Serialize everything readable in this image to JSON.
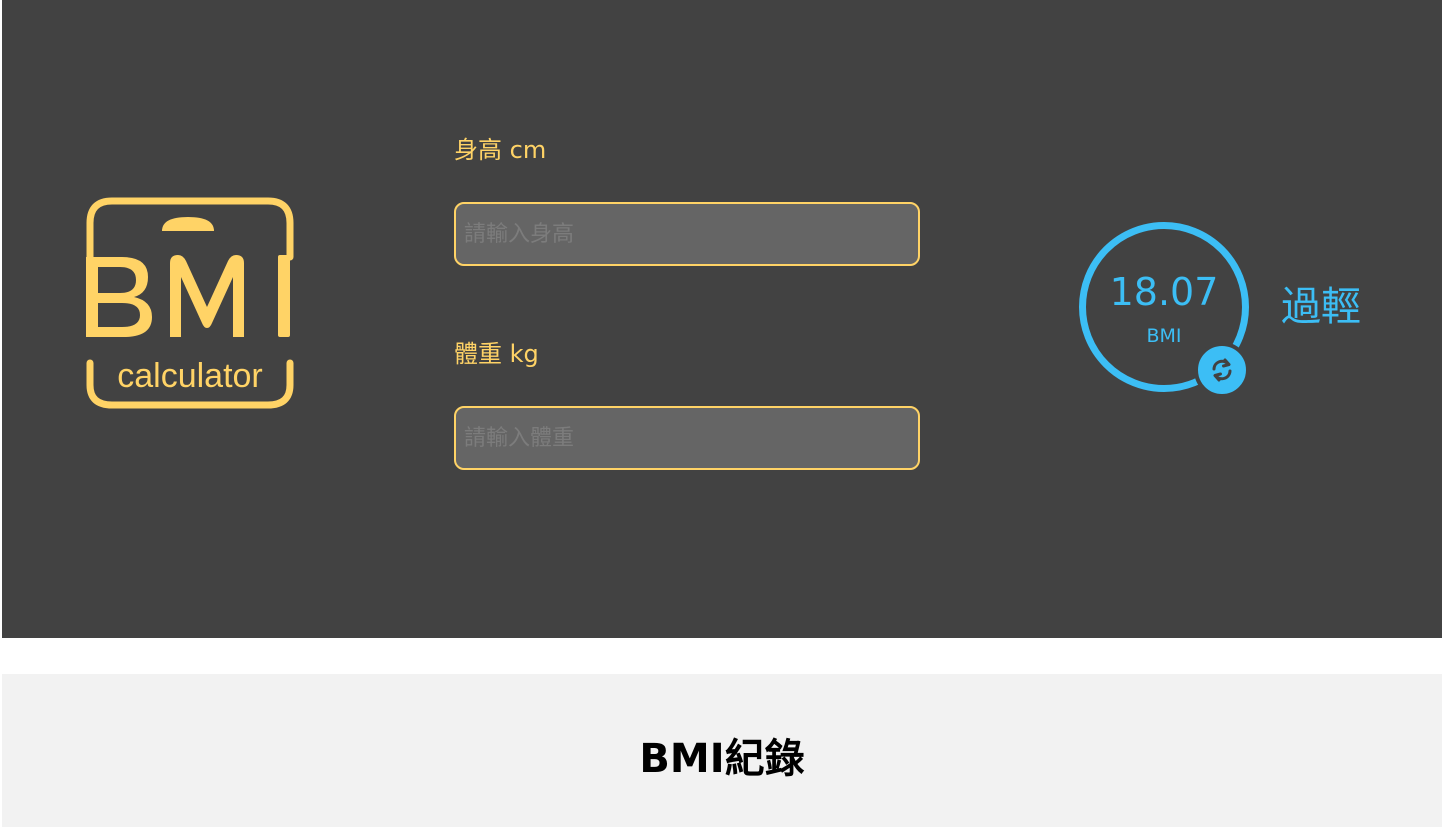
{
  "colors": {
    "header_bg": "#424242",
    "accent_yellow": "#FFD366",
    "result_blue": "#3CBEF5",
    "records_bg": "#F2F2F2"
  },
  "logo": {
    "title": "BMI",
    "subtitle": "calculator"
  },
  "form": {
    "height_label": "身高 cm",
    "height_placeholder": "請輸入身高",
    "height_value": "",
    "weight_label": "體重 kg",
    "weight_placeholder": "請輸入體重",
    "weight_value": ""
  },
  "result": {
    "value": "18.07",
    "unit": "BMI",
    "status": "過輕",
    "reset_icon": "refresh-icon"
  },
  "records": {
    "title": "BMI紀錄"
  }
}
